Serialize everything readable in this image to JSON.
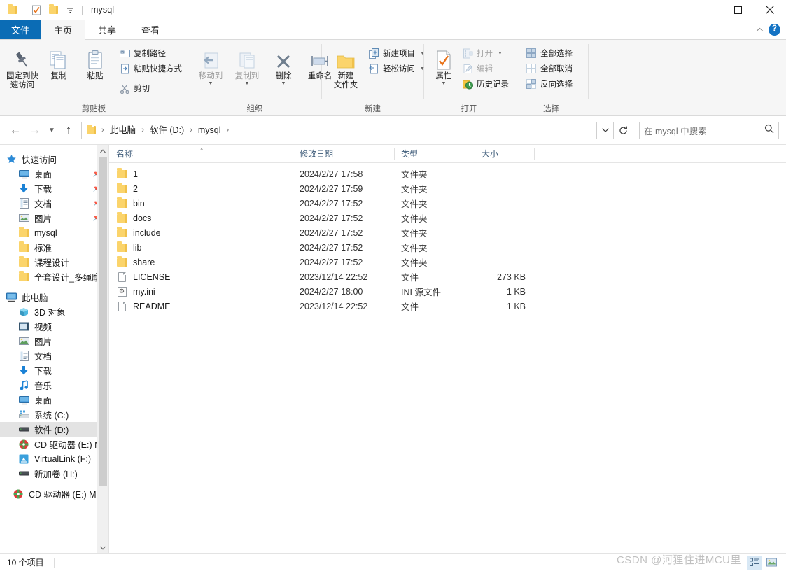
{
  "window": {
    "title": "mysql",
    "quick_access": [
      "folder-icon",
      "properties-icon",
      "new-folder-icon",
      "customize-dropdown"
    ],
    "controls": {
      "minimize": "minimize-icon",
      "maximize": "maximize-icon",
      "close": "close-icon"
    }
  },
  "tabs": [
    {
      "label": "文件",
      "id": "file"
    },
    {
      "label": "主页",
      "id": "home"
    },
    {
      "label": "共享",
      "id": "share"
    },
    {
      "label": "查看",
      "id": "view"
    }
  ],
  "tab_right": {
    "collapse": "chevron-up-icon",
    "help": "?"
  },
  "ribbon": {
    "groups": [
      {
        "label": "剪贴板",
        "big": [
          {
            "label": "固定到快\n速访问",
            "icon": "pin-icon"
          },
          {
            "label": "复制",
            "icon": "copy-icon"
          },
          {
            "label": "粘贴",
            "icon": "paste-icon"
          }
        ],
        "small": [
          {
            "label": "复制路径",
            "icon": "copy-path-icon",
            "dim": false
          },
          {
            "label": "粘贴快捷方式",
            "icon": "paste-shortcut-icon",
            "dim": false
          },
          {
            "label": "剪切",
            "icon": "scissors-icon",
            "dim": false
          }
        ]
      },
      {
        "label": "组织",
        "big": [
          {
            "label": "移动到",
            "icon": "move-to-icon",
            "dim": true,
            "caret": true
          },
          {
            "label": "复制到",
            "icon": "copy-to-icon",
            "dim": true,
            "caret": true
          },
          {
            "label": "删除",
            "icon": "delete-icon",
            "caret": true
          },
          {
            "label": "重命名",
            "icon": "rename-icon"
          }
        ],
        "small": []
      },
      {
        "label": "新建",
        "big": [
          {
            "label": "新建\n文件夹",
            "icon": "new-folder-icon"
          }
        ],
        "small": [
          {
            "label": "新建项目",
            "icon": "new-item-icon",
            "caret": true
          },
          {
            "label": "轻松访问",
            "icon": "easy-access-icon",
            "caret": true
          }
        ]
      },
      {
        "label": "打开",
        "big": [
          {
            "label": "属性",
            "icon": "properties-icon",
            "caret": true
          }
        ],
        "small": [
          {
            "label": "打开",
            "icon": "open-icon",
            "dim": true,
            "caret": true
          },
          {
            "label": "编辑",
            "icon": "edit-icon",
            "dim": true
          },
          {
            "label": "历史记录",
            "icon": "history-icon",
            "dim": false
          }
        ]
      },
      {
        "label": "选择",
        "big": [],
        "small": [
          {
            "label": "全部选择",
            "icon": "select-all-icon"
          },
          {
            "label": "全部取消",
            "icon": "select-none-icon"
          },
          {
            "label": "反向选择",
            "icon": "invert-selection-icon"
          }
        ]
      }
    ]
  },
  "address": {
    "back": "←",
    "forward": "→",
    "recent": "chevron-down-icon",
    "up": "↑",
    "root_icon": "folder-icon",
    "crumbs": [
      "此电脑",
      "软件 (D:)",
      "mysql"
    ],
    "dropdown": "chevron-down-icon",
    "refresh": "refresh-icon"
  },
  "search": {
    "placeholder": "在 mysql 中搜索",
    "icon": "search-icon"
  },
  "sidebar": {
    "items": [
      {
        "label": "快速访问",
        "icon": "star-icon",
        "level": 0,
        "pinned": false
      },
      {
        "label": "桌面",
        "icon": "desktop-icon",
        "level": 1,
        "pinned": true
      },
      {
        "label": "下载",
        "icon": "download-icon",
        "level": 1,
        "pinned": true
      },
      {
        "label": "文档",
        "icon": "documents-icon",
        "level": 1,
        "pinned": true
      },
      {
        "label": "图片",
        "icon": "pictures-icon",
        "level": 1,
        "pinned": true
      },
      {
        "label": "mysql",
        "icon": "folder-icon",
        "level": 1,
        "pinned": false
      },
      {
        "label": "标准",
        "icon": "folder-icon",
        "level": 1,
        "pinned": false
      },
      {
        "label": "课程设计",
        "icon": "folder-icon",
        "level": 1,
        "pinned": false
      },
      {
        "label": "全套设计_多绳摩",
        "icon": "folder-icon",
        "level": 1,
        "pinned": false
      },
      {
        "label": "此电脑",
        "icon": "this-pc-icon",
        "level": 0,
        "pinned": false
      },
      {
        "label": "3D 对象",
        "icon": "3d-objects-icon",
        "level": 1,
        "pinned": false
      },
      {
        "label": "视频",
        "icon": "videos-icon",
        "level": 1,
        "pinned": false
      },
      {
        "label": "图片",
        "icon": "pictures-icon",
        "level": 1,
        "pinned": false
      },
      {
        "label": "文档",
        "icon": "documents-icon",
        "level": 1,
        "pinned": false
      },
      {
        "label": "下载",
        "icon": "download-icon",
        "level": 1,
        "pinned": false
      },
      {
        "label": "音乐",
        "icon": "music-icon",
        "level": 1,
        "pinned": false
      },
      {
        "label": "桌面",
        "icon": "desktop-icon",
        "level": 1,
        "pinned": false
      },
      {
        "label": "系统 (C:)",
        "icon": "system-drive-icon",
        "level": 1,
        "pinned": false
      },
      {
        "label": "软件 (D:)",
        "icon": "drive-icon",
        "level": 1,
        "pinned": false,
        "selected": true
      },
      {
        "label": "CD 驱动器 (E:) M",
        "icon": "cd-drive-icon",
        "level": 1,
        "pinned": false
      },
      {
        "label": "VirtualLink (F:)",
        "icon": "network-drive-icon",
        "level": 1,
        "pinned": false
      },
      {
        "label": "新加卷 (H:)",
        "icon": "drive-icon",
        "level": 1,
        "pinned": false
      },
      {
        "label": "CD 驱动器 (E:) M",
        "icon": "cd-drive-icon",
        "level": 0,
        "pinned": false
      }
    ]
  },
  "columns": [
    {
      "label": "名称",
      "key": "name"
    },
    {
      "label": "修改日期",
      "key": "date"
    },
    {
      "label": "类型",
      "key": "type"
    },
    {
      "label": "大小",
      "key": "size"
    }
  ],
  "sort": {
    "column": "名称",
    "direction": "asc",
    "glyph": "^"
  },
  "files": [
    {
      "name": "1",
      "date": "2024/2/27 17:58",
      "type": "文件夹",
      "size": "",
      "icon": "folder-icon"
    },
    {
      "name": "2",
      "date": "2024/2/27 17:59",
      "type": "文件夹",
      "size": "",
      "icon": "folder-icon"
    },
    {
      "name": "bin",
      "date": "2024/2/27 17:52",
      "type": "文件夹",
      "size": "",
      "icon": "folder-icon"
    },
    {
      "name": "docs",
      "date": "2024/2/27 17:52",
      "type": "文件夹",
      "size": "",
      "icon": "folder-icon"
    },
    {
      "name": "include",
      "date": "2024/2/27 17:52",
      "type": "文件夹",
      "size": "",
      "icon": "folder-icon"
    },
    {
      "name": "lib",
      "date": "2024/2/27 17:52",
      "type": "文件夹",
      "size": "",
      "icon": "folder-icon"
    },
    {
      "name": "share",
      "date": "2024/2/27 17:52",
      "type": "文件夹",
      "size": "",
      "icon": "folder-icon"
    },
    {
      "name": "LICENSE",
      "date": "2023/12/14 22:52",
      "type": "文件",
      "size": "273 KB",
      "icon": "file-icon"
    },
    {
      "name": "my.ini",
      "date": "2024/2/27 18:00",
      "type": "INI 源文件",
      "size": "1 KB",
      "icon": "ini-file-icon"
    },
    {
      "name": "README",
      "date": "2023/12/14 22:52",
      "type": "文件",
      "size": "1 KB",
      "icon": "file-icon"
    }
  ],
  "status": {
    "count": "10 个项目",
    "view_details": "details-view-icon",
    "view_tiles": "tiles-view-icon"
  },
  "watermark": "CSDN @河狸住进MCU里",
  "colors": {
    "file_tab": "#0b6cb5",
    "folder": "#fbd46b",
    "selection": "#e3e3e3",
    "column_header_text": "#3c5a78"
  }
}
